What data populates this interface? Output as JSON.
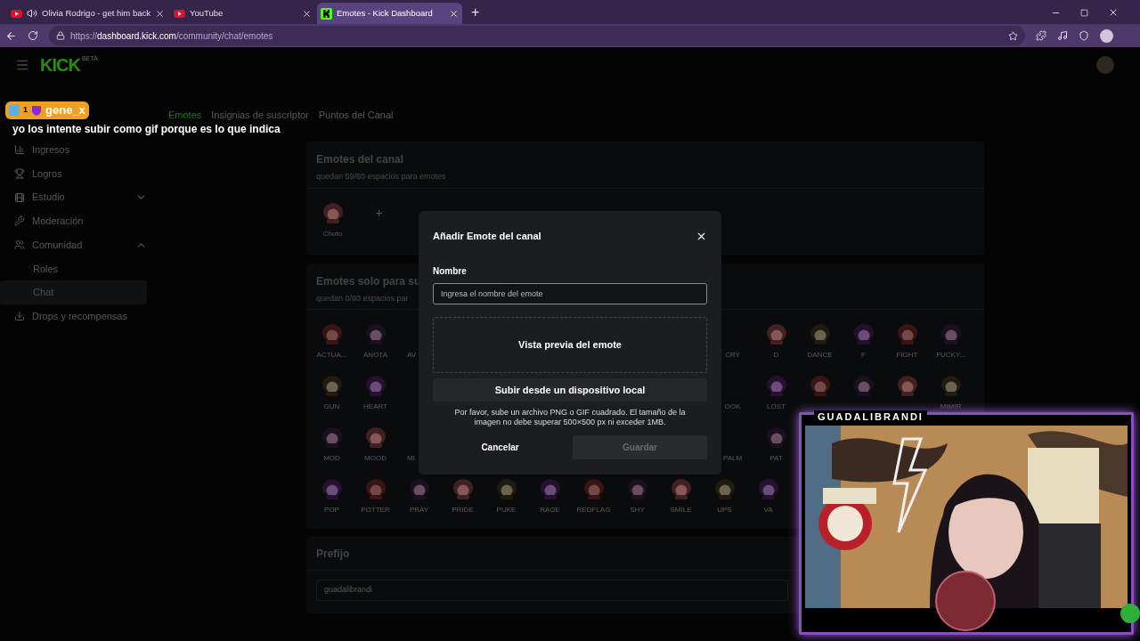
{
  "browser": {
    "tabs": [
      {
        "title": "Olivia Rodrigo - get him back",
        "kind": "video-site",
        "audio": true,
        "selected": false
      },
      {
        "title": "YouTube",
        "kind": "video-site",
        "audio": false,
        "selected": false
      },
      {
        "title": "Emotes - Kick Dashboard",
        "kind": "kick",
        "audio": false,
        "selected": true
      }
    ],
    "new_tab": "+",
    "url": {
      "scheme": "https://",
      "host": "dashboard.kick.com",
      "path": "/community/chat/emotes"
    }
  },
  "header": {
    "logo": "KICK",
    "logo_tag": "BETA"
  },
  "sidebar": {
    "items": [
      {
        "label": "Ingresos",
        "selected": false
      },
      {
        "label": "Logros",
        "selected": false
      },
      {
        "label": "Estudio",
        "selected": false,
        "expanded": false
      },
      {
        "label": "Moderación",
        "selected": false
      },
      {
        "label": "Comunidad",
        "selected": false,
        "expanded": true,
        "children": [
          {
            "label": "Roles",
            "selected": false
          },
          {
            "label": "Chat",
            "selected": true
          }
        ]
      },
      {
        "label": "Drops y recompensas",
        "selected": false
      }
    ]
  },
  "chat_overlay": {
    "badge_count": "1",
    "username": "gene_x",
    "message": "yo los intente subir como gif porque es lo que indica"
  },
  "tabs": [
    {
      "label": "Emotes",
      "selected": true
    },
    {
      "label": "Insignias de suscriptor",
      "selected": false
    },
    {
      "label": "Puntos del Canal",
      "selected": false
    }
  ],
  "channel_emotes": {
    "title": "Emotes del canal",
    "subtitle": "quedan 59/60 espacios para emotes",
    "emotes": [
      {
        "kind": "emote",
        "label": "Choto"
      }
    ],
    "add": "+"
  },
  "sub_emotes": {
    "title": "Emotes solo para su",
    "subtitle": "quedan 0/80 espacios par",
    "rows": [
      {
        "left": [
          {
            "kind": "emote",
            "label": "ACTUA..."
          },
          {
            "kind": "emote",
            "label": "ANOTA"
          },
          {
            "kind": "cut",
            "label": "AV"
          }
        ],
        "right": [
          {
            "kind": "cut",
            "label": "CRY"
          },
          {
            "kind": "emote",
            "label": "D"
          },
          {
            "kind": "emote",
            "label": "DANCE"
          },
          {
            "kind": "emote",
            "label": "F"
          },
          {
            "kind": "emote",
            "label": "FIGHT"
          },
          {
            "kind": "emote",
            "label": "FUCKY..."
          }
        ]
      },
      {
        "left": [
          {
            "kind": "emote",
            "label": "GUN"
          },
          {
            "kind": "emote",
            "label": "HEART"
          }
        ],
        "right": [
          {
            "kind": "cut",
            "label": "OOK"
          },
          {
            "kind": "emote",
            "label": "LOST"
          },
          {
            "kind": "emote"
          },
          {
            "kind": "emote"
          },
          {
            "kind": "emote"
          },
          {
            "kind": "emote",
            "label": "MIMIR"
          }
        ]
      },
      {
        "left": [
          {
            "kind": "emote",
            "label": "MOD"
          },
          {
            "kind": "emote",
            "label": "MOOD"
          },
          {
            "kind": "cut",
            "label": "MI"
          }
        ],
        "right": [
          {
            "kind": "cut",
            "label": "PALM"
          },
          {
            "kind": "emote",
            "label": "PAT"
          }
        ]
      },
      {
        "left": [
          {
            "kind": "emote",
            "label": "POP"
          },
          {
            "kind": "emote",
            "label": "POTTER"
          },
          {
            "kind": "emote",
            "label": "PRAY"
          },
          {
            "kind": "emote",
            "label": "PRIDE"
          },
          {
            "kind": "emote",
            "label": "PUKE"
          },
          {
            "kind": "emote",
            "label": "RAGE"
          },
          {
            "kind": "emote",
            "label": "REDFLAG"
          },
          {
            "kind": "emote",
            "label": "SHY"
          },
          {
            "kind": "emote",
            "label": "SMILE"
          },
          {
            "kind": "emote",
            "label": "UPS"
          },
          {
            "kind": "emote",
            "label": "VA"
          }
        ]
      }
    ]
  },
  "prefix": {
    "title": "Prefijo",
    "value": "guadalibrandi"
  },
  "modal": {
    "title": "Añadir Emote del canal",
    "name_label": "Nombre",
    "name_placeholder": "Ingresa el nombre del emote",
    "preview": "Vista previa del emote",
    "upload": "Subir desde un dispositivo local",
    "help": "Por favor, sube un archivo PNG o GIF cuadrado. El tamaño de la imagen no debe superar 500×500 px ni exceder 1MB.",
    "cancel": "Cancelar",
    "save": "Guardar",
    "save_disabled": true
  },
  "webcam": {
    "label": "GUADALIBRANDI",
    "kind": "picture"
  }
}
